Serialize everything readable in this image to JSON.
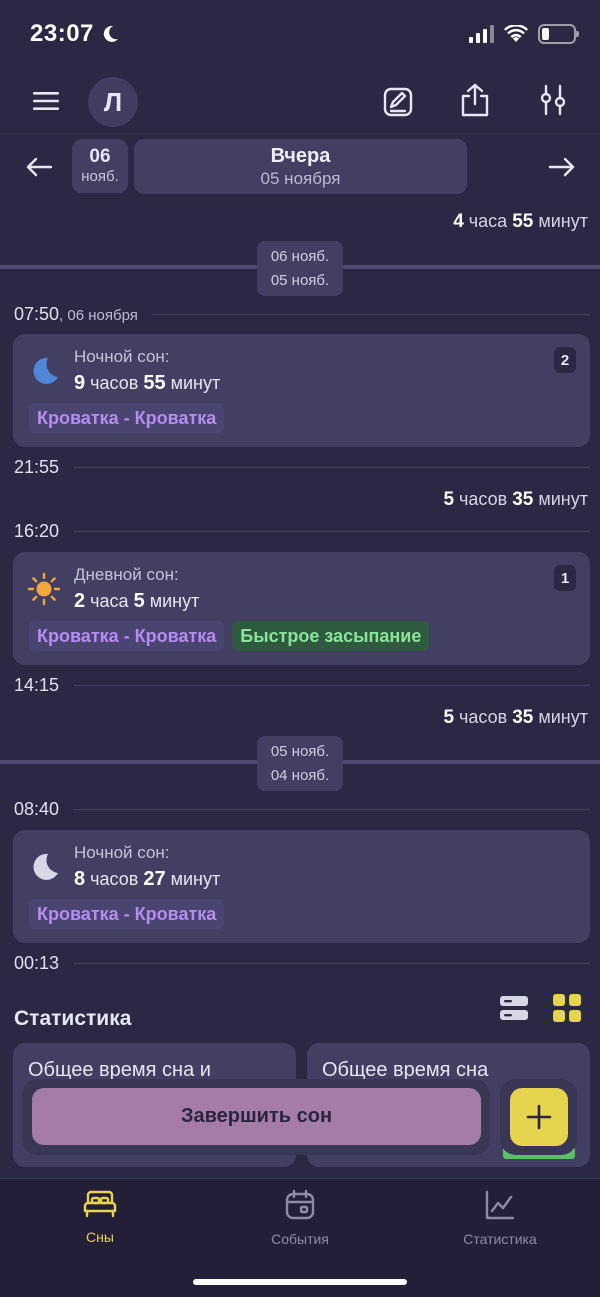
{
  "status": {
    "time": "23:07"
  },
  "header": {
    "avatar_letter": "Л"
  },
  "date_nav": {
    "prev_day": "06",
    "prev_month": "нояб.",
    "title": "Вчера",
    "subtitle": "05 ноября"
  },
  "timeline": {
    "gap1": {
      "h": "4",
      "h_unit": "часа",
      "m": "55",
      "m_unit": "минут"
    },
    "sep1": {
      "top": "06 нояб.",
      "bottom": "05 нояб."
    },
    "t1": {
      "time": "07:50",
      "date": ", 06 ноября"
    },
    "card1": {
      "label": "Ночной сон:",
      "h": "9",
      "h_unit": "часов",
      "m": "55",
      "m_unit": "минут",
      "badge": "2",
      "tags": [
        "Кроватка - Кроватка"
      ]
    },
    "t2": {
      "time": "21:55"
    },
    "gap2": {
      "h": "5",
      "h_unit": "часов",
      "m": "35",
      "m_unit": "минут"
    },
    "t3": {
      "time": "16:20"
    },
    "card2": {
      "label": "Дневной сон:",
      "h": "2",
      "h_unit": "часа",
      "m": "5",
      "m_unit": "минут",
      "badge": "1",
      "tags": [
        "Кроватка - Кроватка",
        "Быстрое засыпание"
      ]
    },
    "t4": {
      "time": "14:15"
    },
    "gap3": {
      "h": "5",
      "h_unit": "часов",
      "m": "35",
      "m_unit": "минут"
    },
    "sep2": {
      "top": "05 нояб.",
      "bottom": "04 нояб."
    },
    "t5": {
      "time": "08:40"
    },
    "card3": {
      "label": "Ночной сон:",
      "h": "8",
      "h_unit": "часов",
      "m": "27",
      "m_unit": "минут",
      "tags": [
        "Кроватка - Кроватка"
      ]
    },
    "t6": {
      "time": "00:13"
    }
  },
  "stats": {
    "title": "Статистика",
    "card1_title": "Общее время сна и",
    "card2_title": "Общее время сна"
  },
  "actions": {
    "finish_label": "Завершить сон"
  },
  "tabs": [
    {
      "label": "Сны",
      "icon": "bed-icon",
      "active": true
    },
    {
      "label": "События",
      "icon": "calendar-icon",
      "active": false
    },
    {
      "label": "Статистика",
      "icon": "chart-icon",
      "active": false
    }
  ],
  "colors": {
    "background": "#2b2844",
    "card": "#433f63",
    "accent_yellow": "#e6d34e",
    "tag_purple": "#b68cf0",
    "tag_green": "#8ce49c",
    "finish_button": "#a47ca6"
  }
}
